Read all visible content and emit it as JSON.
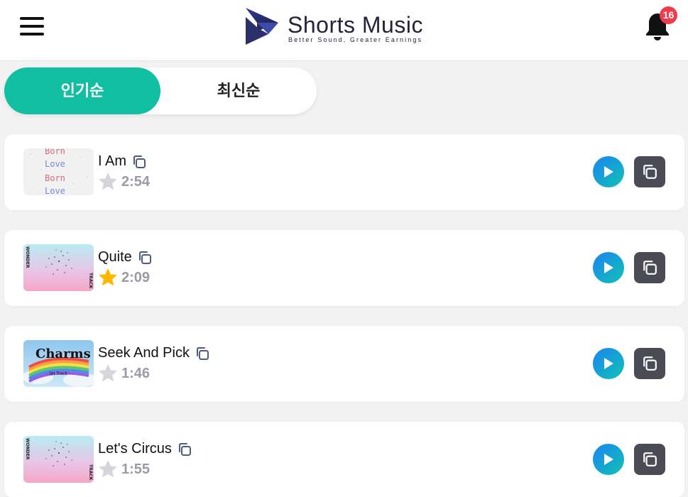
{
  "header": {
    "menu_icon": "hamburger-menu-icon",
    "logo_title": "Shorts Music",
    "logo_subtitle": "Better Sound, Greater Earnings",
    "notification_icon": "bell-icon",
    "notification_count": "16"
  },
  "sort": {
    "tabs": [
      {
        "label": "인기순",
        "active": true
      },
      {
        "label": "최신순",
        "active": false
      }
    ]
  },
  "colors": {
    "accent": "#10bfa2",
    "badge": "#ef3b4c",
    "star_active": "#ffb800",
    "star_inactive": "#d6d6da",
    "copy_button": "#4a4b55"
  },
  "tracks": [
    {
      "title": "I Am",
      "duration": "2:54",
      "favorite": false,
      "thumb_text": [
        "Born",
        "Love",
        "Born",
        "Love"
      ],
      "thumb_style": "handwritten"
    },
    {
      "title": "Quite",
      "duration": "2:09",
      "favorite": true,
      "thumb_text": [
        "WONDER",
        "TRACK"
      ],
      "thumb_style": "pastel-burst"
    },
    {
      "title": "Seek And Pick",
      "duration": "1:46",
      "favorite": false,
      "thumb_text": [
        "Charms",
        "- SH Track -"
      ],
      "thumb_style": "rainbow-sky"
    },
    {
      "title": "Let's Circus",
      "duration": "1:55",
      "favorite": false,
      "thumb_text": [
        "WONDER",
        "TRACK"
      ],
      "thumb_style": "pastel-burst"
    }
  ]
}
